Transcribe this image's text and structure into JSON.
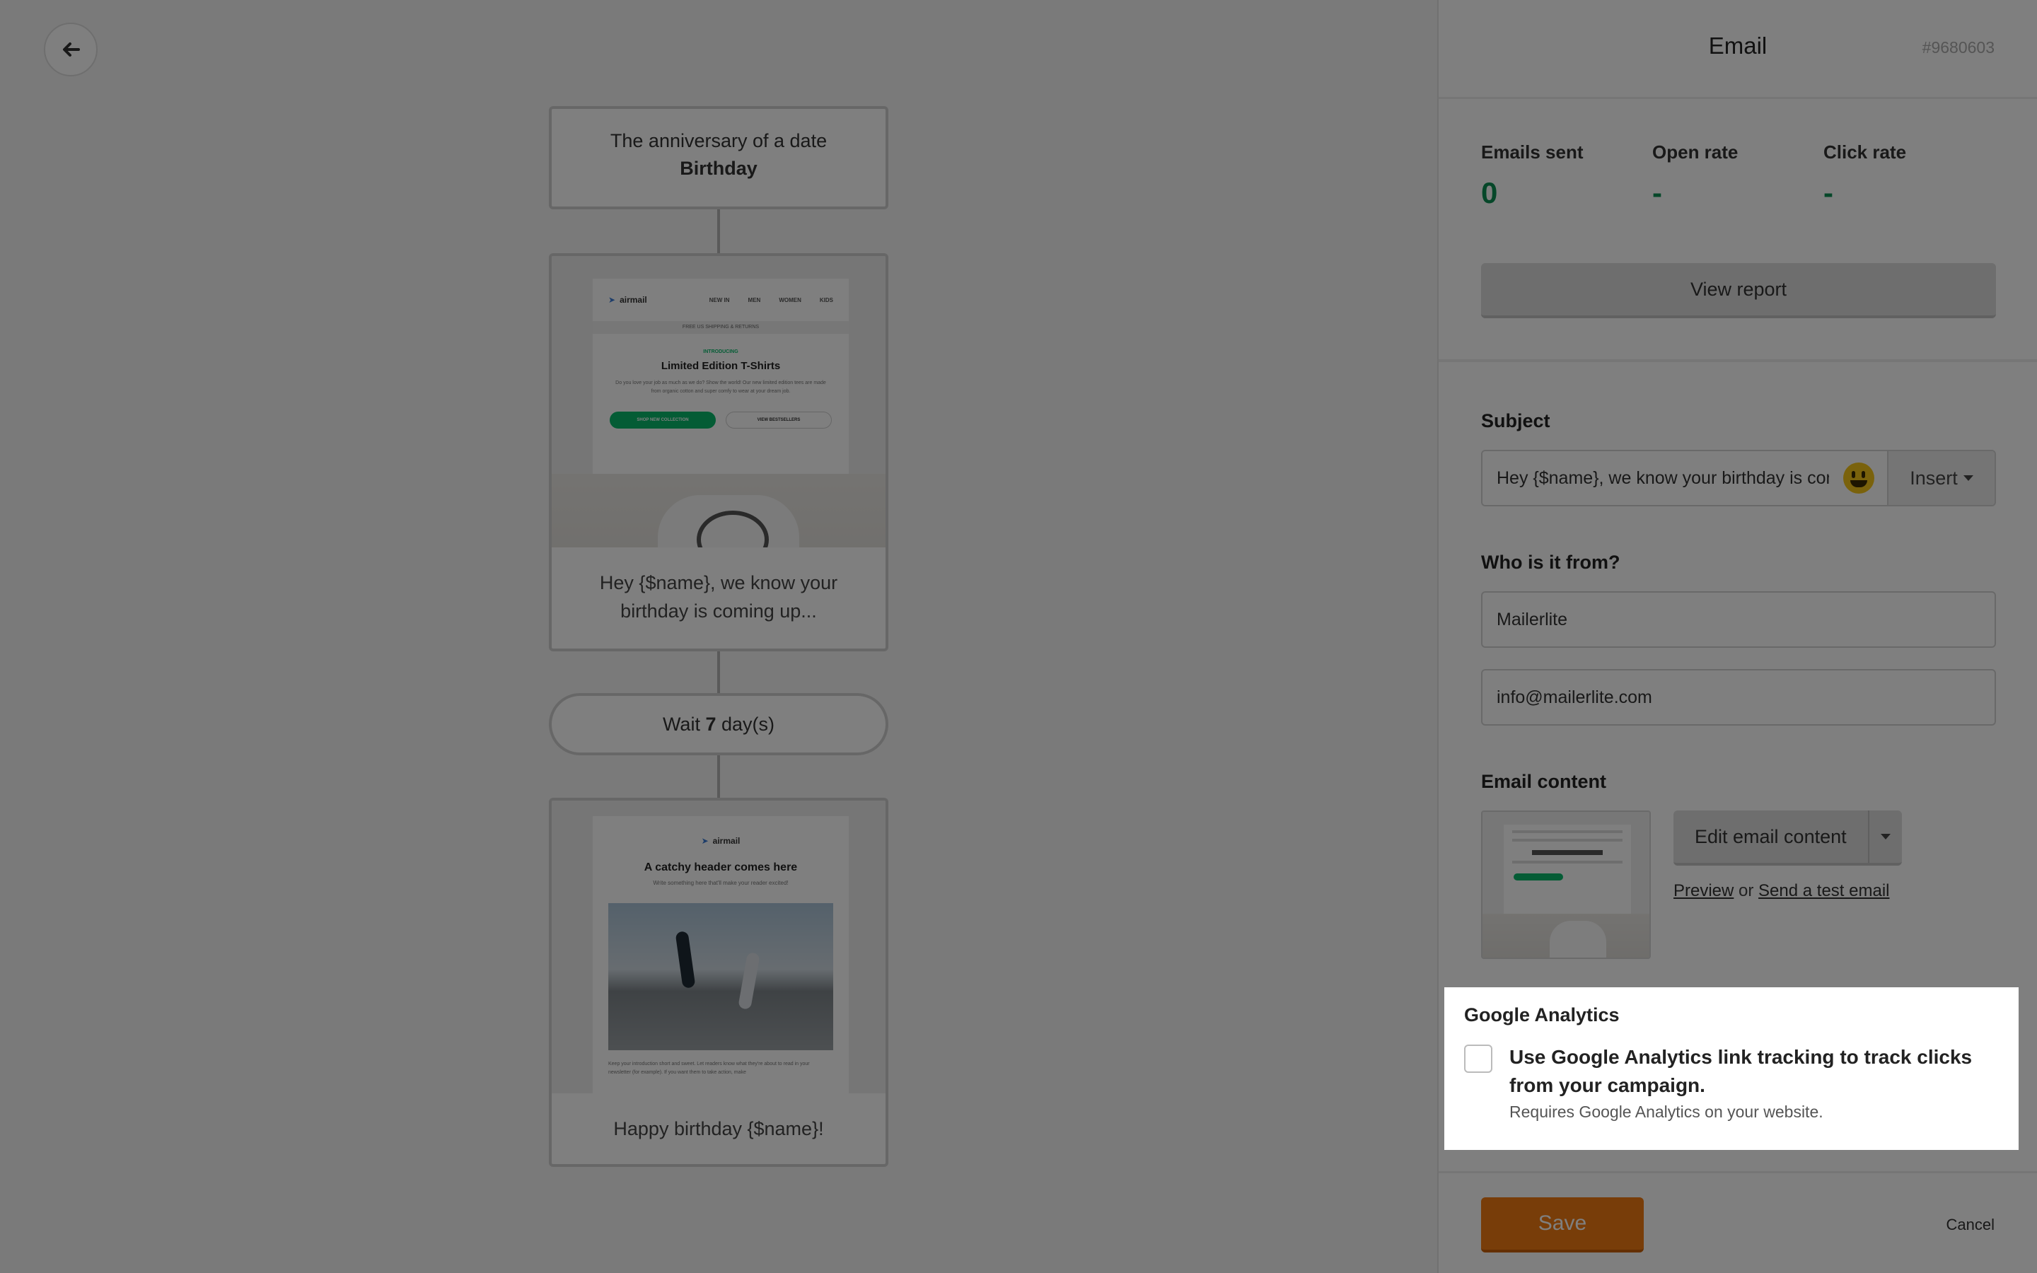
{
  "canvas": {
    "trigger": {
      "line1": "The anniversary of a date",
      "line2": "Birthday"
    },
    "email1": {
      "caption": "Hey {$name}, we know your birthday is coming up...",
      "preview": {
        "brand": "airmail",
        "menu": [
          "NEW IN",
          "MEN",
          "WOMEN",
          "KIDS"
        ],
        "strip": "FREE US SHIPPING & RETURNS",
        "tag": "INTRODUCING",
        "headline": "Limited Edition T-Shirts",
        "body": "Do you love your job as much as we do? Show the world! Our new limited edition tees are made from organic cotton and super comfy to wear at your dream job.",
        "primary_btn": "SHOP NEW COLLECTION",
        "secondary_btn": "VIEW BESTSELLERS"
      }
    },
    "wait": {
      "prefix": "Wait",
      "value": "7",
      "suffix": "day(s)"
    },
    "email2": {
      "caption": "Happy birthday {$name}!",
      "preview": {
        "brand": "airmail",
        "headline": "A catchy header comes here",
        "sub": "Write something here that'll make your reader excited!",
        "body": "Keep your introduction short and sweet. Let readers know what they're about to read in your newsletter (for example). If you want them to take action, make"
      }
    }
  },
  "panel": {
    "title": "Email",
    "id": "#9680603",
    "stats": [
      {
        "label": "Emails sent",
        "value": "0"
      },
      {
        "label": "Open rate",
        "value": "-"
      },
      {
        "label": "Click rate",
        "value": "-"
      }
    ],
    "view_report": "View report",
    "subject": {
      "label": "Subject",
      "value": "Hey {$name}, we know your birthday is coming up...",
      "insert": "Insert"
    },
    "from": {
      "label": "Who is it from?",
      "name": "Mailerlite",
      "email": "info@mailerlite.com"
    },
    "content": {
      "label": "Email content",
      "edit": "Edit email content",
      "preview": "Preview",
      "or": "or",
      "send_test": "Send a test email"
    },
    "ga": {
      "title": "Google Analytics",
      "option": "Use Google Analytics link tracking to track clicks from your campaign.",
      "hint": "Requires Google Analytics on your website."
    },
    "footer": {
      "save": "Save",
      "cancel": "Cancel"
    }
  },
  "colors": {
    "accent": "#f07a12",
    "stat_green": "#0d8f52",
    "brand_green": "#09b96a"
  },
  "icons": [
    "back-arrow-icon",
    "caret-down-icon",
    "emoji-icon"
  ]
}
